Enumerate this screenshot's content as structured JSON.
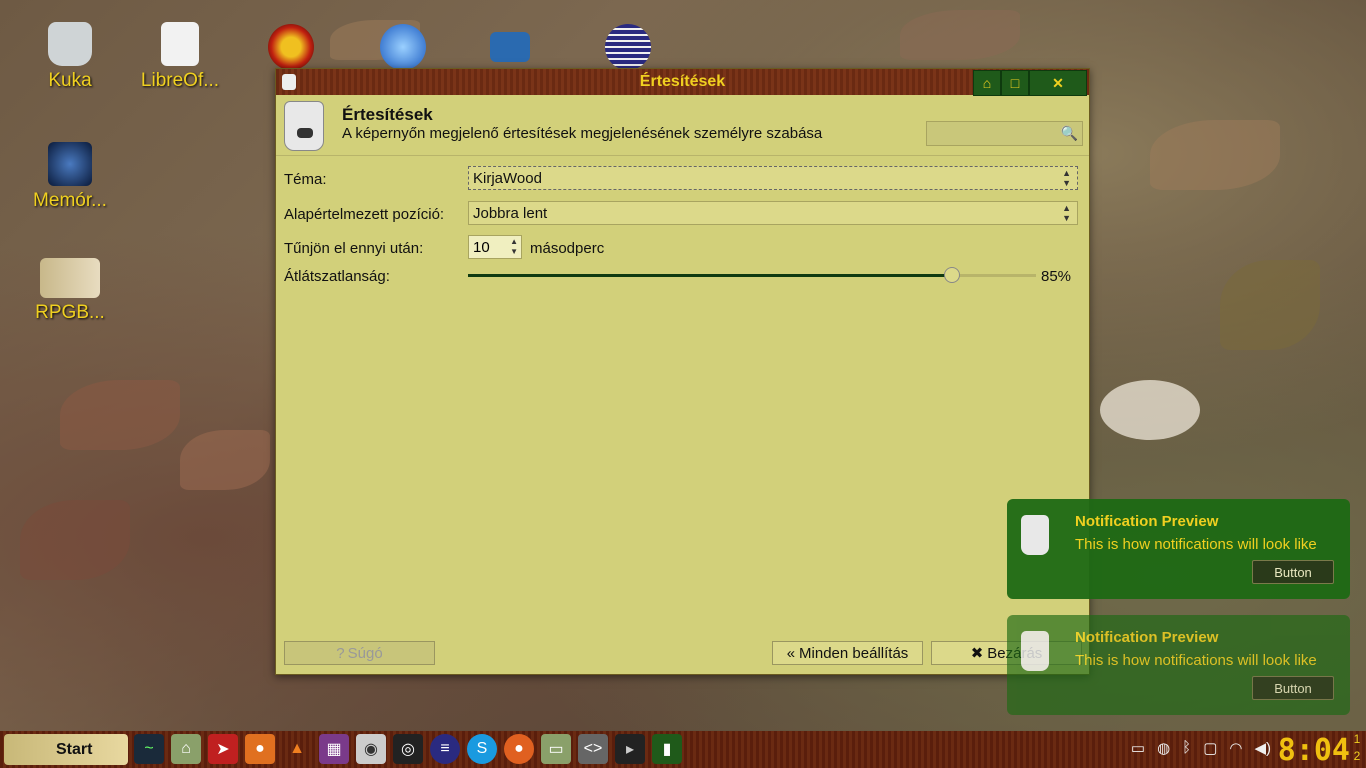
{
  "desktop": {
    "icons": [
      {
        "label": "Kuka",
        "icon": "trash-icon"
      },
      {
        "label": "LibreOf...",
        "icon": "libreoffice-icon"
      },
      {
        "label": "Memór...",
        "icon": "memory-app-icon"
      },
      {
        "label": "RPGB...",
        "icon": "book-icon"
      }
    ]
  },
  "window": {
    "title": "Értesítések",
    "header_title": "Értesítések",
    "header_subtitle": "A képernyőn megjelenő értesítések megjelenésének személyre szabása",
    "search_placeholder": "",
    "fields": {
      "theme_label": "Téma:",
      "theme_value": "KirjaWood",
      "position_label": "Alapértelmezett pozíció:",
      "position_value": "Jobbra lent",
      "timeout_label": "Tűnjön el ennyi után:",
      "timeout_value": "10",
      "timeout_unit": "másodperc",
      "opacity_label": "Átlátszatlanság:",
      "opacity_value": 85,
      "opacity_text": "85%"
    },
    "buttons": {
      "help": "Súgó",
      "all_settings": "Minden beállítás",
      "close": "Bezárás"
    }
  },
  "notifications": [
    {
      "title": "Notification Preview",
      "body": "This is how notifications will look like",
      "button": "Button"
    },
    {
      "title": "Notification Preview",
      "body": "This is how notifications will look like",
      "button": "Button"
    }
  ],
  "taskbar": {
    "start_label": "Start",
    "clock": "8:04",
    "workspaces": [
      "1",
      "2"
    ]
  },
  "colors": {
    "window_bg": "#d2d07a",
    "title_text": "#f0d020",
    "notification_bg": "#1f6a14",
    "slider_fill": "#103a10"
  }
}
